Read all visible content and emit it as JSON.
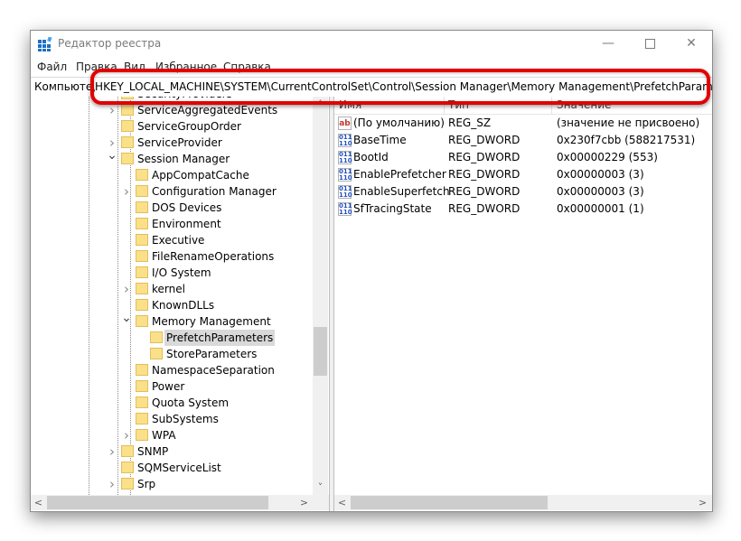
{
  "window": {
    "title": "Редактор реестра",
    "controls": {
      "minimize": "—",
      "maximize": "",
      "close": "✕"
    }
  },
  "menu": [
    "Файл",
    "Правка",
    "Вид",
    "Избранное",
    "Справка"
  ],
  "address": {
    "prefix": "Компьюте",
    "path": "\\HKEY_LOCAL_MACHINE\\SYSTEM\\CurrentControlSet\\Control\\Session Manager\\Memory Management\\PrefetchParameters"
  },
  "tree": {
    "items": [
      {
        "label": "SecurityProviders",
        "level": 0,
        "expander": "none"
      },
      {
        "label": "ServiceAggregatedEvents",
        "level": 0,
        "expander": "collapsed"
      },
      {
        "label": "ServiceGroupOrder",
        "level": 0,
        "expander": "none"
      },
      {
        "label": "ServiceProvider",
        "level": 0,
        "expander": "collapsed"
      },
      {
        "label": "Session Manager",
        "level": 0,
        "expander": "expanded"
      },
      {
        "label": "AppCompatCache",
        "level": 1,
        "expander": "none"
      },
      {
        "label": "Configuration Manager",
        "level": 1,
        "expander": "collapsed"
      },
      {
        "label": "DOS Devices",
        "level": 1,
        "expander": "none"
      },
      {
        "label": "Environment",
        "level": 1,
        "expander": "none"
      },
      {
        "label": "Executive",
        "level": 1,
        "expander": "none"
      },
      {
        "label": "FileRenameOperations",
        "level": 1,
        "expander": "none"
      },
      {
        "label": "I/O System",
        "level": 1,
        "expander": "none"
      },
      {
        "label": "kernel",
        "level": 1,
        "expander": "collapsed"
      },
      {
        "label": "KnownDLLs",
        "level": 1,
        "expander": "none"
      },
      {
        "label": "Memory Management",
        "level": 1,
        "expander": "expanded"
      },
      {
        "label": "PrefetchParameters",
        "level": 2,
        "expander": "none",
        "selected": true
      },
      {
        "label": "StoreParameters",
        "level": 2,
        "expander": "none"
      },
      {
        "label": "NamespaceSeparation",
        "level": 1,
        "expander": "none"
      },
      {
        "label": "Power",
        "level": 1,
        "expander": "none"
      },
      {
        "label": "Quota System",
        "level": 1,
        "expander": "none"
      },
      {
        "label": "SubSystems",
        "level": 1,
        "expander": "none"
      },
      {
        "label": "WPA",
        "level": 1,
        "expander": "collapsed"
      },
      {
        "label": "SNMP",
        "level": 0,
        "expander": "collapsed"
      },
      {
        "label": "SQMServiceList",
        "level": 0,
        "expander": "none"
      },
      {
        "label": "Srp",
        "level": 0,
        "expander": "collapsed"
      }
    ]
  },
  "list": {
    "columns": [
      "Имя",
      "Тип",
      "Значение"
    ],
    "rows": [
      {
        "icon": "string-value-icon",
        "name": "(По умолчанию)",
        "type": "REG_SZ",
        "data": "(значение не присвоено)"
      },
      {
        "icon": "binary-value-icon",
        "name": "BaseTime",
        "type": "REG_DWORD",
        "data": "0x230f7cbb (588217531)"
      },
      {
        "icon": "binary-value-icon",
        "name": "BootId",
        "type": "REG_DWORD",
        "data": "0x00000229 (553)"
      },
      {
        "icon": "binary-value-icon",
        "name": "EnablePrefetcher",
        "type": "REG_DWORD",
        "data": "0x00000003 (3)"
      },
      {
        "icon": "binary-value-icon",
        "name": "EnableSuperfetch",
        "type": "REG_DWORD",
        "data": "0x00000003 (3)"
      },
      {
        "icon": "binary-value-icon",
        "name": "SfTracingState",
        "type": "REG_DWORD",
        "data": "0x00000001 (1)"
      }
    ]
  },
  "scroll": {
    "up": "˄",
    "down": "˅",
    "left": "<",
    "right": ">"
  },
  "colors": {
    "highlight": "#e30000",
    "folder": "#fbe08a",
    "selection": "#d9d9d9"
  }
}
